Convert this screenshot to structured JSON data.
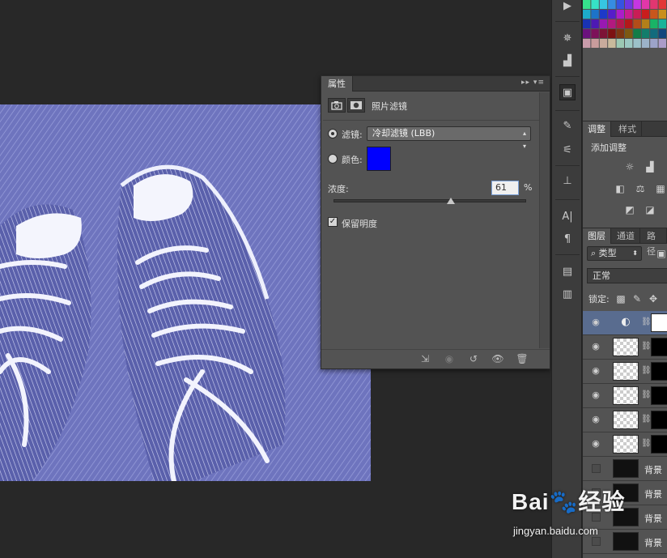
{
  "properties_panel": {
    "tab_label": "属性",
    "adjustment_title": "照片滤镜",
    "filter_label": "滤镜:",
    "filter_value": "冷却滤镜 (LBB)",
    "color_label": "颜色:",
    "color_value": "#0000ff",
    "density_label": "浓度:",
    "density_value": "61",
    "density_unit": "%",
    "density_percent": 61,
    "preserve_luminosity_label": "保留明度",
    "preserve_luminosity_checked": true
  },
  "adjustments_panel": {
    "tabs": [
      "调整",
      "样式"
    ],
    "add_adjustment_label": "添加调整"
  },
  "layers_panel": {
    "tabs": [
      "图层",
      "通道",
      "路径"
    ],
    "filter_label": "类型",
    "blend_mode": "正常",
    "lock_label": "锁定:",
    "layers": [
      {
        "visible": true,
        "name": ""
      },
      {
        "visible": true,
        "name": ""
      },
      {
        "visible": true,
        "name": ""
      },
      {
        "visible": true,
        "name": ""
      },
      {
        "visible": true,
        "name": ""
      },
      {
        "visible": true,
        "name": ""
      },
      {
        "visible": false,
        "name": "背景"
      },
      {
        "visible": false,
        "name": "背景"
      },
      {
        "visible": false,
        "name": "背景"
      },
      {
        "visible": false,
        "name": "背景"
      }
    ]
  },
  "watermark": {
    "brand": "Bai",
    "brand_suffix": "经验",
    "url": "jingyan.baidu.com"
  },
  "colors": {
    "canvas_tint": "#6e74be",
    "selected_layer": "#596c8f"
  }
}
